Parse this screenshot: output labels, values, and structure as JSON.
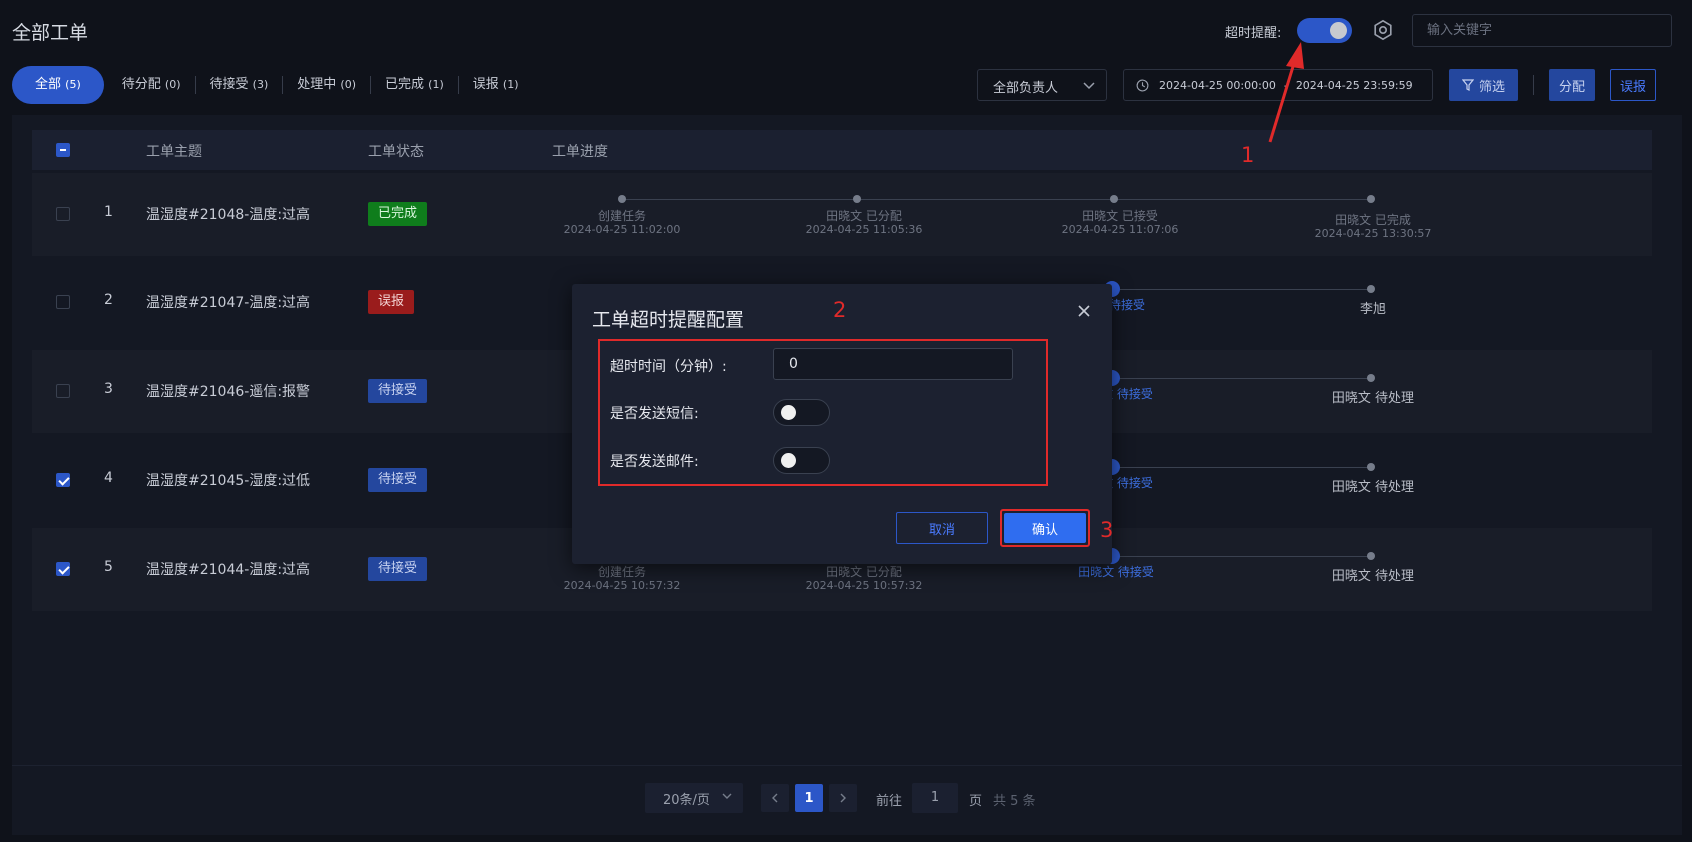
{
  "header": {
    "title": "全部工单",
    "timeout_label": "超时提醒:",
    "timeout_enabled": true,
    "search_placeholder": "输入关键字"
  },
  "tabs": [
    {
      "label": "全部",
      "count": "(5)",
      "active": true
    },
    {
      "label": "待分配",
      "count": "(0)"
    },
    {
      "label": "待接受",
      "count": "(3)"
    },
    {
      "label": "处理中",
      "count": "(0)"
    },
    {
      "label": "已完成",
      "count": "(1)"
    },
    {
      "label": "误报",
      "count": "(1)"
    }
  ],
  "toolbar": {
    "owner_select": "全部负责人",
    "date_start": "2024-04-25 00:00:00",
    "date_sep": "-",
    "date_end": "2024-04-25 23:59:59",
    "filter_label": "筛选",
    "assign_label": "分配",
    "false_report_label": "误报"
  },
  "table": {
    "columns": [
      "工单主题",
      "工单状态",
      "工单进度"
    ],
    "rows": [
      {
        "index": "1",
        "subject": "温湿度#21048-温度:过高",
        "status": "已完成",
        "checked": false,
        "steps": [
          {
            "who": "创建任务",
            "time": "2024-04-25 11:02:00"
          },
          {
            "who": "田晓文 已分配",
            "time": "2024-04-25 11:05:36"
          },
          {
            "who": "田晓文 已接受",
            "time": "2024-04-25 11:07:06"
          },
          {
            "who": "田晓文 已完成",
            "time": "2024-04-25 13:30:57"
          }
        ]
      },
      {
        "index": "2",
        "subject": "温湿度#21047-温度:过高",
        "status": "误报",
        "checked": false,
        "steps": [
          {
            "who": "待接受"
          },
          {
            "who": "李旭"
          }
        ]
      },
      {
        "index": "3",
        "subject": "温湿度#21046-遥信:报警",
        "status": "待接受",
        "checked": false,
        "steps": [
          {
            "who": "文 待接受"
          },
          {
            "who": "田晓文 待处理"
          }
        ]
      },
      {
        "index": "4",
        "subject": "温湿度#21045-湿度:过低",
        "status": "待接受",
        "checked": true,
        "steps": [
          {
            "who": "文 待接受"
          },
          {
            "who": "田晓文 待处理"
          }
        ]
      },
      {
        "index": "5",
        "subject": "温湿度#21044-温度:过高",
        "status": "待接受",
        "checked": true,
        "steps": [
          {
            "who": "创建任务",
            "time": "2024-04-25 10:57:32"
          },
          {
            "who": "田晓文 已分配",
            "time": "2024-04-25 10:57:32"
          },
          {
            "who": "田晓文 待接受"
          },
          {
            "who": "田晓文 待处理"
          }
        ]
      }
    ]
  },
  "pagination": {
    "page_size": "20条/页",
    "current_page": "1",
    "goto_label": "前往",
    "goto_value": "1",
    "page_suffix": "页",
    "total": "共 5 条"
  },
  "modal": {
    "title": "工单超时提醒配置",
    "timeout_minutes_label": "超时时间（分钟）:",
    "timeout_minutes_value": "0",
    "send_sms_label": "是否发送短信:",
    "send_sms": false,
    "send_email_label": "是否发送邮件:",
    "send_email": false,
    "cancel_label": "取消",
    "confirm_label": "确认"
  },
  "annotations": {
    "one": "1",
    "two": "2",
    "three": "3"
  },
  "colors": {
    "accent": "#2c57c8",
    "annotation": "#e02a2a",
    "done": "#0f7d1c",
    "false_report": "#9a1c1c"
  }
}
